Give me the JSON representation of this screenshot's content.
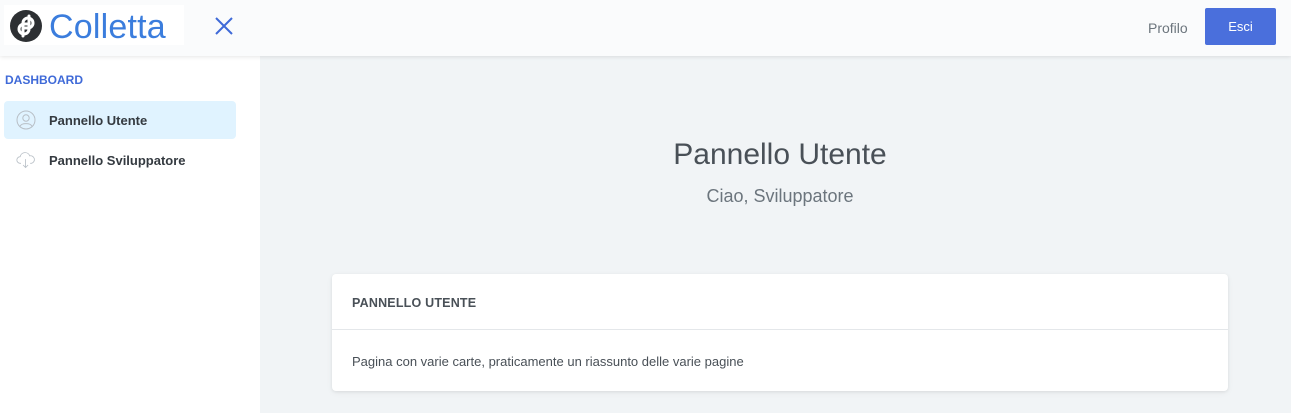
{
  "header": {
    "logo_text": "Colletta",
    "profile_label": "Profilo",
    "logout_label": "Esci"
  },
  "sidebar": {
    "heading": "DASHBOARD",
    "items": [
      {
        "label": "Pannello Utente",
        "icon": "user-icon",
        "active": true
      },
      {
        "label": "Pannello Sviluppatore",
        "icon": "cloud-download-icon",
        "active": false
      }
    ]
  },
  "main": {
    "title": "Pannello Utente",
    "subtitle": "Ciao, Sviluppatore",
    "card": {
      "header": "PANNELLO UTENTE",
      "body": "Pagina con varie carte, praticamente un riassunto delle varie pagine"
    }
  },
  "colors": {
    "accent": "#3f6ad8",
    "button": "#4a6fdc",
    "active_item_bg": "#e0f3ff",
    "page_bg": "#f1f4f6"
  }
}
